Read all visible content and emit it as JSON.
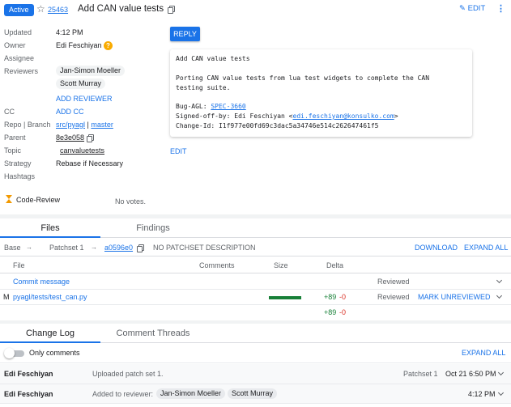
{
  "header": {
    "status": "Active",
    "change_number": "25463",
    "subject": "Add CAN value tests",
    "edit_label": "EDIT",
    "more_label": "⋮"
  },
  "metadata": {
    "updated": {
      "label": "Updated",
      "value": "4:12 PM"
    },
    "owner": {
      "label": "Owner",
      "value": "Edi Feschiyan",
      "help": "?"
    },
    "assignee": {
      "label": "Assignee"
    },
    "reviewers": {
      "label": "Reviewers",
      "values": [
        "Jan-Simon Moeller",
        "Scott Murray"
      ],
      "add_label": "ADD REVIEWER"
    },
    "cc": {
      "label": "CC",
      "add_label": "ADD CC"
    },
    "repo_branch": {
      "label": "Repo | Branch",
      "repo": "src/pyagl",
      "separator": "|",
      "branch": "master"
    },
    "parent": {
      "label": "Parent",
      "value": "8e3e058"
    },
    "topic": {
      "label": "Topic",
      "value": "canvaluetests"
    },
    "strategy": {
      "label": "Strategy",
      "value": "Rebase if Necessary"
    },
    "hashtags": {
      "label": "Hashtags"
    }
  },
  "commit_message": {
    "reply_label": "REPLY",
    "lines": [
      "Add CAN value tests",
      "",
      "Porting CAN value tests from lua test widgets to complete the CAN",
      "testing suite.",
      "",
      "Bug-AGL: ",
      "Signed-off-by: Edi Feschiyan <",
      "Change-Id: I1f977e00fd69c3dac5a34746e514c262647461f5"
    ],
    "bug_link": "SPEC-3660",
    "email_link": "edi.feschiyan@konsulko.com",
    "email_close": ">",
    "edit_label": "EDIT"
  },
  "code_review": {
    "label": "Code-Review",
    "value": "No votes."
  },
  "file_tabs": [
    "Files",
    "Findings"
  ],
  "patchset_bar": {
    "base": "Base",
    "arrow": "→",
    "patchset": "Patchset 1",
    "commit": "a0596e0",
    "description": "NO PATCHSET DESCRIPTION",
    "download_label": "DOWNLOAD",
    "expand_label": "EXPAND ALL"
  },
  "file_table": {
    "headers": [
      "File",
      "Comments",
      "Size",
      "Delta"
    ],
    "commit_message_row": {
      "name": "Commit message",
      "status": "Reviewed"
    },
    "file_row": {
      "status_letter": "M",
      "path": "pyagl/tests/test_can.py",
      "added": "+89",
      "removed": "-0",
      "reviewed": "Reviewed",
      "mark_label": "MARK UNREVIEWED"
    },
    "total_row": {
      "added": "+89",
      "removed": "-0"
    },
    "size_fraction": 0.85
  },
  "log_tabs": [
    "Change Log",
    "Comment Threads"
  ],
  "change_log": {
    "only_comments_label": "Only comments",
    "expand_label": "EXPAND ALL",
    "entries": [
      {
        "author": "Edi Feschiyan",
        "message": "Uploaded patch set 1.",
        "patchset": "Patchset 1",
        "time": "Oct 21 6:50 PM"
      },
      {
        "author": "Edi Feschiyan",
        "prefix": "Added to reviewer:",
        "reviewers": [
          "Jan-Simon Moeller",
          "Scott Murray"
        ],
        "time": "4:12 PM"
      }
    ]
  },
  "colors": {
    "accent": "#1a73e8",
    "added": "#188038",
    "removed": "#d93025",
    "warning": "#f9ab00"
  }
}
